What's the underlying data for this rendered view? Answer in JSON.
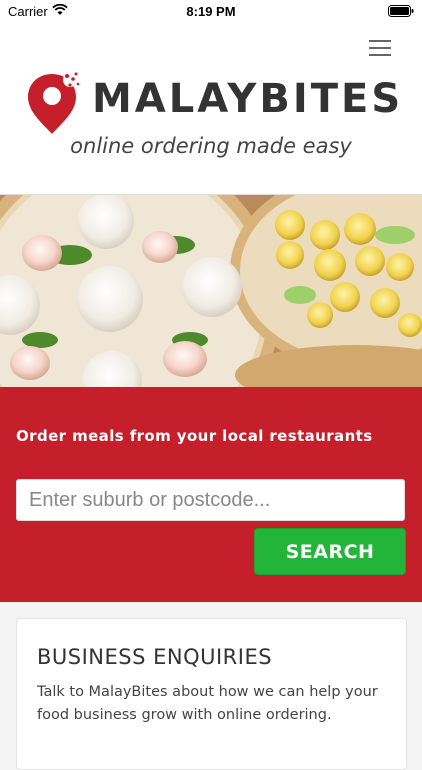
{
  "status_bar": {
    "carrier": "Carrier",
    "time": "8:19 PM"
  },
  "header": {
    "brand": "MALAYBITES",
    "tagline": "online ordering made easy",
    "brand_color": "#c41f2a"
  },
  "hero": {
    "image": "dumplings-bamboo-steamers"
  },
  "order": {
    "heading": "Order meals from your local restaurants",
    "search_placeholder": "Enter suburb or postcode...",
    "search_value": "",
    "search_button": "SEARCH",
    "panel_color": "#c41f2a",
    "button_color": "#23b53a"
  },
  "enquiries": {
    "title": "BUSINESS ENQUIRIES",
    "text": "Talk to MalayBites about how we can help your food business grow with online ordering."
  }
}
